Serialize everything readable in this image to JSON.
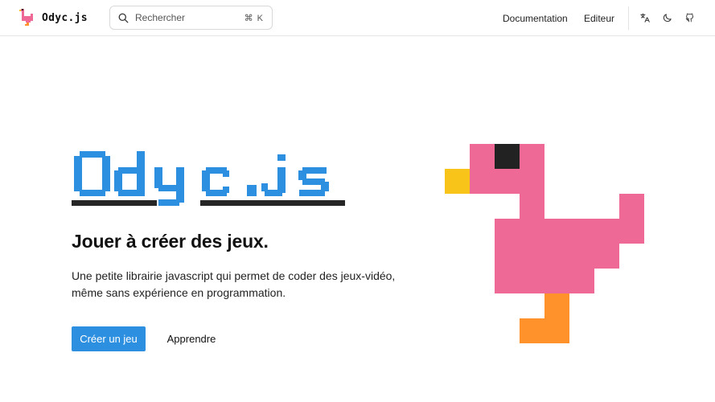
{
  "header": {
    "brand": {
      "text": "Odyc.js",
      "logo": "duck-logo-icon"
    },
    "search": {
      "placeholder": "Rechercher",
      "shortcut": "⌘ K",
      "icon": "search-icon"
    },
    "nav": [
      {
        "label": "Documentation"
      },
      {
        "label": "Editeur"
      }
    ],
    "icons": [
      "translate-icon",
      "moon-icon",
      "github-icon"
    ]
  },
  "hero": {
    "logo_text": "Odyc.js",
    "title": "Jouer à créer des jeux.",
    "description": "Une petite librairie javascript qui permet de coder des jeux-vidéo, même sans expérience en programmation.",
    "primary_button": "Créer un jeu",
    "secondary_button": "Apprendre"
  },
  "colors": {
    "accent_blue": "#2d8fe0",
    "duck_pink": "#ef6996",
    "beak_yellow": "#f8c41a",
    "leg_orange": "#ff922b",
    "eye_dark": "#222222"
  }
}
